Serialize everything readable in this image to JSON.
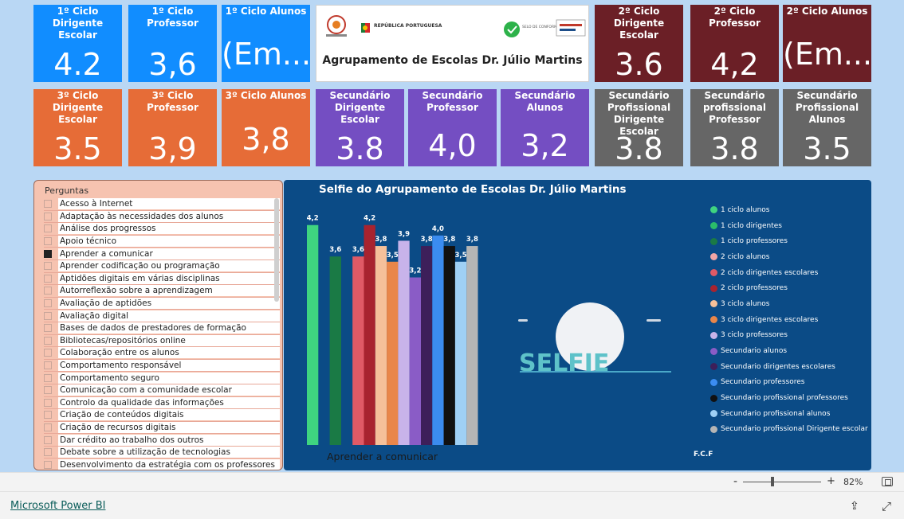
{
  "kpis": [
    {
      "label": "1º Ciclo Dirigente Escolar",
      "value": "4.2",
      "color": "#118dff"
    },
    {
      "label": "1º Ciclo Professor",
      "value": "3,6",
      "color": "#118dff"
    },
    {
      "label": "1º Ciclo Alunos",
      "value": "(Em...",
      "color": "#118dff"
    },
    {
      "label": "2º Ciclo Dirigente Escolar",
      "value": "3.6",
      "color": "#6b1f26"
    },
    {
      "label": "2º Ciclo Professor",
      "value": "4,2",
      "color": "#6b1f26"
    },
    {
      "label": "2º Ciclo Alunos",
      "value": "(Em...",
      "color": "#6b1f26"
    },
    {
      "label": "3º Ciclo Dirigente Escolar",
      "value": "3.5",
      "color": "#e66c37"
    },
    {
      "label": "3º Ciclo Professor",
      "value": "3,9",
      "color": "#e66c37"
    },
    {
      "label": "3º Ciclo Alunos",
      "value": "3,8",
      "color": "#e66c37"
    },
    {
      "label": "Secundário Dirigente Escolar",
      "value": "3.8",
      "color": "#744ec2"
    },
    {
      "label": "Secundário Professor",
      "value": "4,0",
      "color": "#744ec2"
    },
    {
      "label": "Secundário Alunos",
      "value": "3,2",
      "color": "#744ec2"
    },
    {
      "label": "Secundário Profissional Dirigente Escolar",
      "value": "3.8",
      "color": "#666666"
    },
    {
      "label": "Secundário profissional Professor",
      "value": "3.8",
      "color": "#666666"
    },
    {
      "label": "Secundário Profissional Alunos",
      "value": "3.5",
      "color": "#666666"
    }
  ],
  "logo": {
    "title": "Agrupamento de Escolas Dr. Júlio Martins",
    "republica": "REPÚBLICA PORTUGUESA",
    "selo": "SELO DE CONFORMIDADE EQAVET"
  },
  "slicer": {
    "title": "Perguntas",
    "items": [
      {
        "label": "Acesso à Internet",
        "checked": false
      },
      {
        "label": "Adaptação às necessidades dos alunos",
        "checked": false
      },
      {
        "label": "Análise dos progressos",
        "checked": false
      },
      {
        "label": "Apoio técnico",
        "checked": false
      },
      {
        "label": "Aprender a comunicar",
        "checked": true
      },
      {
        "label": "Aprender codificação ou programação",
        "checked": false
      },
      {
        "label": "Aptidões digitais em várias disciplinas",
        "checked": false
      },
      {
        "label": "Autorreflexão sobre a aprendizagem",
        "checked": false
      },
      {
        "label": "Avaliação de aptidões",
        "checked": false
      },
      {
        "label": "Avaliação digital",
        "checked": false
      },
      {
        "label": "Bases de dados de prestadores de formação",
        "checked": false
      },
      {
        "label": "Bibliotecas/repositórios online",
        "checked": false
      },
      {
        "label": "Colaboração entre os alunos",
        "checked": false
      },
      {
        "label": "Comportamento responsável",
        "checked": false
      },
      {
        "label": "Comportamento seguro",
        "checked": false
      },
      {
        "label": "Comunicação com a comunidade escolar",
        "checked": false
      },
      {
        "label": "Controlo da qualidade das informações",
        "checked": false
      },
      {
        "label": "Criação de conteúdos digitais",
        "checked": false
      },
      {
        "label": "Criação de recursos digitais",
        "checked": false
      },
      {
        "label": "Dar crédito ao trabalho dos outros",
        "checked": false
      },
      {
        "label": "Debate sobre a utilização de tecnologias",
        "checked": false
      },
      {
        "label": "Desenvolvimento da estratégia com os professores",
        "checked": false
      }
    ]
  },
  "chart_data": {
    "type": "bar",
    "title": "Selfie do Agrupamento de Escolas Dr. Júlio Martins",
    "categories": [
      "Aprender a comunicar"
    ],
    "ylim": [
      0,
      4.5
    ],
    "series": [
      {
        "name": "1 ciclo alunos",
        "color": "#3fd480",
        "value": 4.2,
        "label": "4,2"
      },
      {
        "name": "1 ciclo dirigentes",
        "color": "#2bbd6a",
        "value": null,
        "label": ""
      },
      {
        "name": "1 ciclo professores",
        "color": "#1a7a45",
        "value": 3.6,
        "label": "3,6"
      },
      {
        "name": "2 ciclo alunos",
        "color": "#f2a6a6",
        "value": null,
        "label": ""
      },
      {
        "name": "2 ciclo dirigentes escolares",
        "color": "#e05a66",
        "value": 3.6,
        "label": "3,6"
      },
      {
        "name": "2 ciclo professores",
        "color": "#a8232f",
        "value": 4.2,
        "label": "4,2"
      },
      {
        "name": "3 ciclo alunos",
        "color": "#f5c09a",
        "value": 3.8,
        "label": "3,8"
      },
      {
        "name": "3 ciclo dirigentes escolares",
        "color": "#e9864a",
        "value": 3.5,
        "label": "3,5"
      },
      {
        "name": "3 ciclo professores",
        "color": "#c8b3ea",
        "value": 3.9,
        "label": "3,9"
      },
      {
        "name": "Secundario alunos",
        "color": "#8a5cc6",
        "value": 3.2,
        "label": "3,2"
      },
      {
        "name": "Secundario dirigentes escolares",
        "color": "#3d1f5a",
        "value": 3.8,
        "label": "3,8"
      },
      {
        "name": "Secundario professores",
        "color": "#3b8cf0",
        "value": 4.0,
        "label": "4,0"
      },
      {
        "name": "Secundario profissional professores",
        "color": "#111111",
        "value": 3.8,
        "label": "3,8"
      },
      {
        "name": "Secundario profissional alunos",
        "color": "#9fd0f5",
        "value": 3.5,
        "label": "3,5"
      },
      {
        "name": "Secundario profissional Dirigente escolar",
        "color": "#b5b5b5",
        "value": 3.8,
        "label": "3,8"
      }
    ],
    "xlabel": "Aprender a comunicar",
    "legend_position": "right",
    "grid": false
  },
  "chart_extra": {
    "selfie_text": "SELFIE",
    "credit": "F.C.F"
  },
  "zoom": {
    "minus": "-",
    "plus": "+",
    "level": "82%",
    "fraction": 0.36
  },
  "footer": {
    "brand": "Microsoft Power BI"
  },
  "icons": {
    "share": "share-icon",
    "expand": "expand-icon",
    "fit": "fit-to-page-icon"
  }
}
